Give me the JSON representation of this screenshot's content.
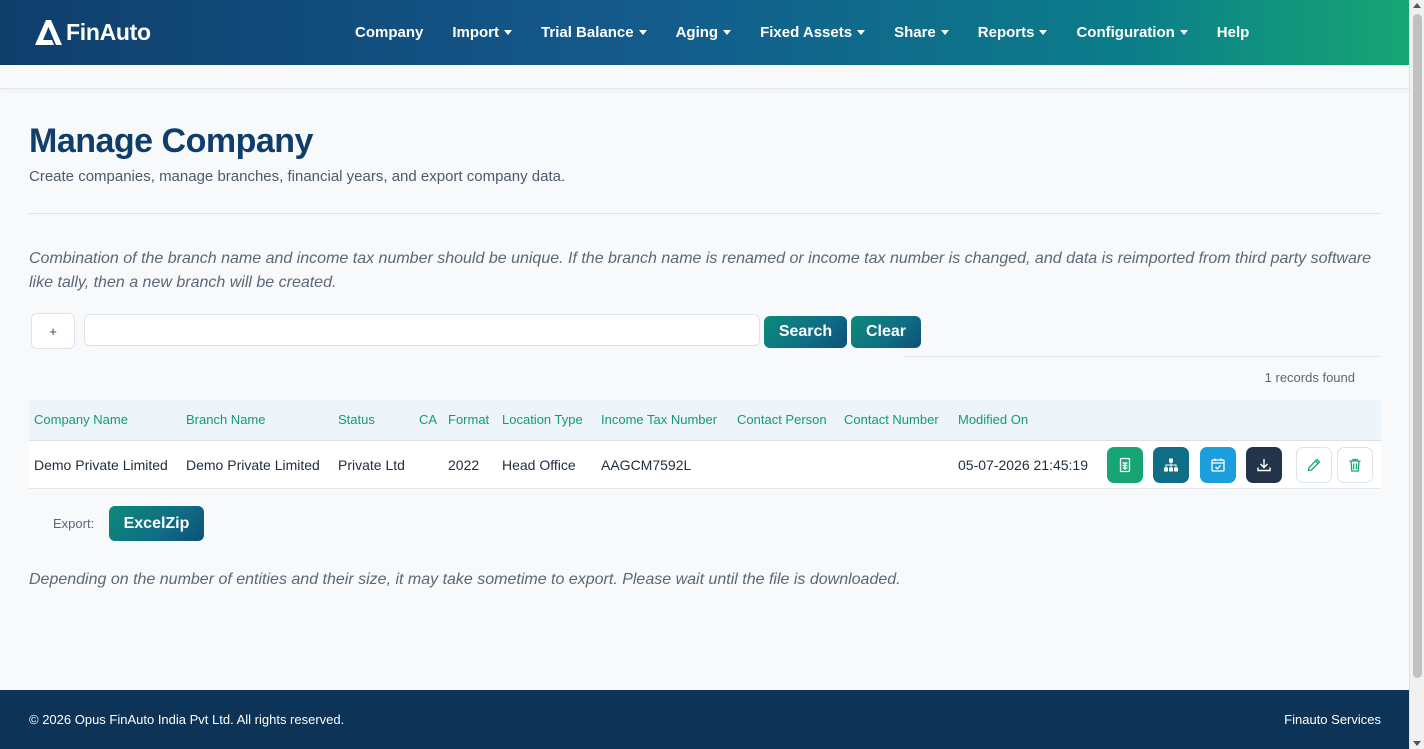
{
  "brand": {
    "name": "FinAuto"
  },
  "nav": [
    {
      "label": "Company",
      "dropdown": false
    },
    {
      "label": "Import",
      "dropdown": true
    },
    {
      "label": "Trial Balance",
      "dropdown": true
    },
    {
      "label": "Aging",
      "dropdown": true
    },
    {
      "label": "Fixed Assets",
      "dropdown": true
    },
    {
      "label": "Share",
      "dropdown": true
    },
    {
      "label": "Reports",
      "dropdown": true
    },
    {
      "label": "Configuration",
      "dropdown": true
    },
    {
      "label": "Help",
      "dropdown": false
    }
  ],
  "page": {
    "title": "Manage Company",
    "subtitle": "Create companies, manage branches, financial years, and export company data.",
    "note": "Combination of the branch name and income tax number should be unique. If the branch name is renamed or income tax number is changed, and data is reimported from third party software like tally, then a new branch will be created."
  },
  "search": {
    "add_label": "+",
    "value": "",
    "placeholder": "",
    "search_label": "Search",
    "clear_label": "Clear",
    "records_text": "1 records found"
  },
  "table": {
    "columns": [
      "Company Name",
      "Branch Name",
      "Status",
      "CA",
      "Format",
      "Location Type",
      "Income Tax Number",
      "Contact Person",
      "Contact Number",
      "Modified On"
    ],
    "rows": [
      {
        "company_name": "Demo Private Limited",
        "branch_name": "Demo Private Limited",
        "status": "Private Ltd",
        "ca": "",
        "format": "2022",
        "location_type": "Head Office",
        "income_tax_number": "AAGCM7592L",
        "contact_person": "",
        "contact_number": "",
        "modified_on": "05-07-2026 21:45:19",
        "actions": [
          "spreadsheet-icon",
          "hierarchy-icon",
          "calendar-check-icon",
          "download-icon",
          "pencil-icon",
          "trash-icon"
        ]
      }
    ]
  },
  "export": {
    "label": "Export:",
    "button_label": "ExcelZip",
    "note": "Depending on the number of entities and their size, it may take sometime to export. Please wait until the file is downloaded."
  },
  "footer": {
    "copyright": "© 2026 Opus FinAuto India Pvt Ltd. All rights reserved.",
    "services": "Finauto Services"
  },
  "colors": {
    "nav_start": "#0f3e6b",
    "nav_end": "#17a673",
    "title": "#0f3e6b",
    "header_text": "#129a7a",
    "footer_bg": "#0d3357"
  }
}
